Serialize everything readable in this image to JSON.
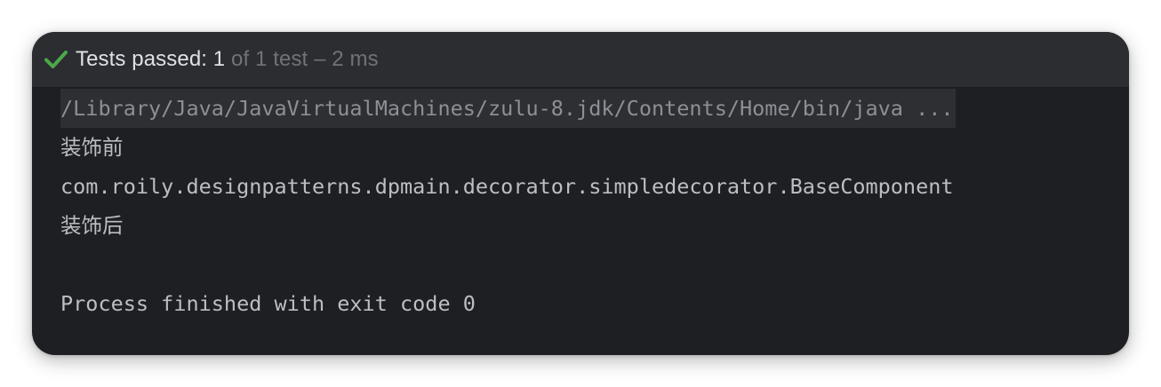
{
  "status": {
    "icon": "check-icon",
    "icon_color": "#4da84c",
    "passed_label": "Tests passed: 1",
    "detail": " of 1 test – 2 ms"
  },
  "console": {
    "command": "/Library/Java/JavaVirtualMachines/zulu-8.jdk/Contents/Home/bin/java ...",
    "lines": [
      "装饰前",
      "com.roily.designpatterns.dpmain.decorator.simpledecorator.BaseComponent",
      "装饰后",
      "",
      "Process finished with exit code 0"
    ]
  }
}
